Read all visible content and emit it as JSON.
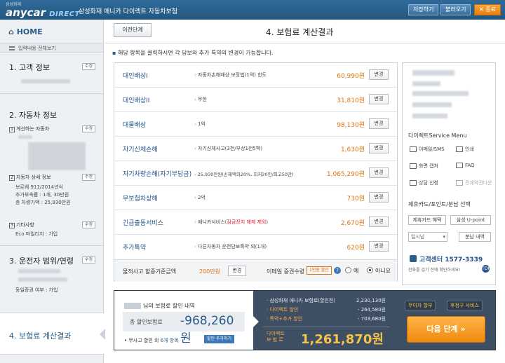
{
  "topbar": {
    "logo_small": "삼성화재",
    "logo_brand": "anycar",
    "logo_direct": "DIRECT",
    "title": "삼성화재 애니카 다이렉트 자동차보험",
    "buttons": [
      "저장하기",
      "불러오기",
      "✕ 종료"
    ]
  },
  "sidebar": {
    "home": "HOME",
    "view_all": "입력내용 전체보기",
    "sections": [
      {
        "title": "1. 고객 정보",
        "edit": "수정"
      },
      {
        "title": "2. 자동차 정보",
        "edit": "수정"
      },
      {
        "title": "3. 운전자 범위/연령",
        "edit": "수정"
      }
    ],
    "car": {
      "sub1_num": "1",
      "sub1_label": "계산하는 자동차",
      "sub1_edit": "수정",
      "sub2_num": "2",
      "sub2_label": "자동차 상세 정보",
      "sub2_edit": "수정",
      "details": [
        "보르웨 911/2014년식",
        "추가부속품 : 1개, 30만원",
        "총 차량가액 : 25,930만원"
      ],
      "sub3_num": "3",
      "sub3_label": "기타사항",
      "sub3_edit": "수정",
      "eco": "Eco 마일리지 : 가입"
    },
    "driver_extra": "동일증권 여부 : 가입",
    "active": "4. 보험료 계산결과"
  },
  "header": {
    "back": "이전단계",
    "title": "4. 보험료 계산결과"
  },
  "notice": "해당 항목을 클릭하시면 각 담보와 추가 특약의 변경이 가능합니다.",
  "coverages": [
    {
      "name": "대인배상I",
      "detail": "자동차손해배상 보장법(1억) 한도",
      "price": "60,990원",
      "btn": "변경"
    },
    {
      "name": "대인배상II",
      "detail": "무한",
      "price": "31,810원",
      "btn": "변경"
    },
    {
      "name": "대물배상",
      "detail": "1억",
      "price": "98,130원",
      "btn": "변경"
    },
    {
      "name": "자기신체손해",
      "detail": "자기신체사고(3천/부상1천5백)",
      "price": "1,630원",
      "btn": "변경"
    },
    {
      "name": "자기차량손해(자기부담금)",
      "detail": "25,930만원(손해액의20%, 최저20만/최고50만)",
      "price": "1,065,290원",
      "btn": "변경"
    },
    {
      "name": "무보험차상해",
      "detail": "2억",
      "price": "730원",
      "btn": "변경"
    },
    {
      "name": "긴급출동서비스",
      "detail": "애니카서비스(",
      "detail_red": "잠금장치 해제 제외",
      "detail_end": ")",
      "price": "2,670원",
      "btn": "변경"
    },
    {
      "name": "추가특약",
      "detail": "다른자동차 운전담보특약 외(1개)",
      "price": "620원",
      "btn": "변경"
    }
  ],
  "foot": {
    "label": "물적사고 할증기준금액",
    "amount": "200만원",
    "btn": "변경",
    "email_label": "이메일 증권수령",
    "badge": "1만원 할인",
    "q": "?",
    "yes": "예",
    "no": "아니요"
  },
  "right": {
    "menu_title": "다이렉트Service Menu",
    "menu_items": [
      "이메일/SMS",
      "인쇄",
      "화면 캡처",
      "FAQ",
      "상담 신청",
      "전체약관다운"
    ],
    "card_title": "제휴카드/포인트/분납 선택",
    "card_btn": "제휴카드 혜택",
    "upoint_btn": "삼성 U-point",
    "select_value": "일시납",
    "installment_btn": "분납 내역",
    "cs_label": "고객센터",
    "cs_number": "1577-3339",
    "cs_sub": "전화를 걸기 전에 확인하세요!",
    "top": "TOP"
  },
  "summary": {
    "head_suffix": "님의 보험료 할인 내역",
    "total_label": "총 할인보험료",
    "total_value": "-968,260원",
    "note_prefix": "무사고 할인 외 ",
    "note_link": "6개 항목",
    "note_tag": "할인 추가하기",
    "rows": [
      {
        "label": "삼성화재 애니카 보험료(할인전)",
        "value": "2,230,130원"
      },
      {
        "label": "다이렉트 할인",
        "value": "- 264,580원"
      },
      {
        "label": "특약+추가 할인",
        "value": "- 703,680원"
      }
    ],
    "final_label_1": "다이렉트",
    "final_label_2": "보 험 료",
    "final_value": "1,261,870원",
    "btn1": "무이자 할부",
    "btn2": "후정구 서비스",
    "next": "다음 단계 »"
  }
}
